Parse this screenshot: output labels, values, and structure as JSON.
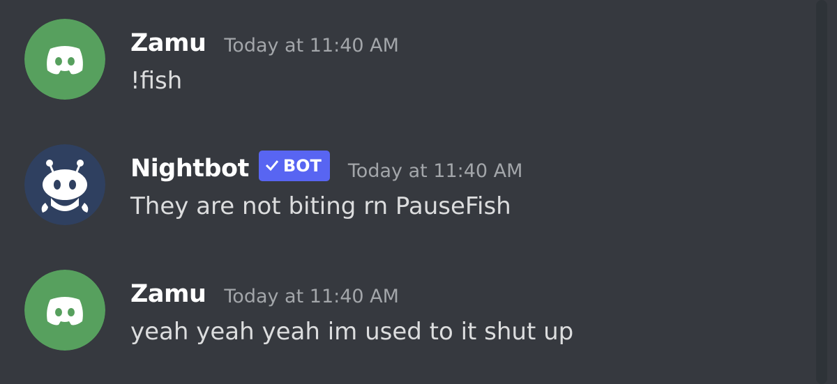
{
  "messages": [
    {
      "author": "Zamu",
      "avatar": {
        "icon": "discord-logo-icon",
        "bg": "#57a05e"
      },
      "is_bot": false,
      "timestamp": "Today at 11:40 AM",
      "content": "!fish"
    },
    {
      "author": "Nightbot",
      "avatar": {
        "icon": "nightbot-robot-icon",
        "bg": "#2f4060"
      },
      "is_bot": true,
      "bot_tag": "BOT",
      "timestamp": "Today at 11:40 AM",
      "content": "They are not biting rn PauseFish"
    },
    {
      "author": "Zamu",
      "avatar": {
        "icon": "discord-logo-icon",
        "bg": "#57a05e"
      },
      "is_bot": false,
      "timestamp": "Today at 11:40 AM",
      "content": "yeah yeah yeah im used to it shut up"
    }
  ],
  "colors": {
    "background": "#36393f",
    "username": "#ffffff",
    "timestamp": "#a3a6aa",
    "message_text": "#dcddde",
    "bot_tag": "#5865f2",
    "scrollbar": "#2e3338"
  }
}
